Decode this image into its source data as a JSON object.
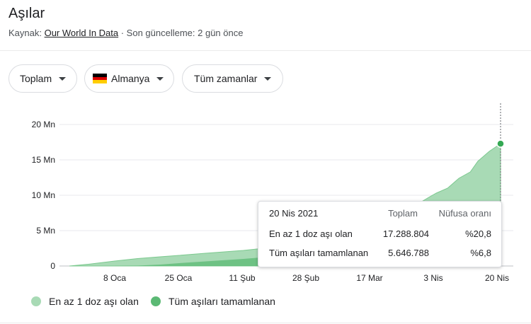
{
  "header": {
    "title": "Aşılar",
    "source_prefix": "Kaynak: ",
    "source_link": "Our World In Data",
    "source_suffix": " · Son güncelleme: 2 gün önce"
  },
  "filters": [
    {
      "label": "Toplam"
    },
    {
      "label": "Almanya",
      "flag": [
        "#000000",
        "#dd0000",
        "#ffce00"
      ]
    },
    {
      "label": "Tüm zamanlar"
    }
  ],
  "tooltip": {
    "date": "20 Nis 2021",
    "col1": "Toplam",
    "col2": "Nüfusa oranı",
    "rows": [
      {
        "label": "En az 1 doz aşı olan",
        "total": "17.288.804",
        "pct": "%20,8"
      },
      {
        "label": "Tüm aşıları tamamlanan",
        "total": "5.646.788",
        "pct": "%6,8"
      }
    ]
  },
  "legend": [
    {
      "label": "En az 1 doz aşı olan",
      "color": "#a8dab5"
    },
    {
      "label": "Tüm aşıları tamamlanan",
      "color": "#5bb974"
    }
  ],
  "chart_data": {
    "type": "area",
    "y_ticks": [
      "0",
      "5 Mn",
      "10 Mn",
      "15 Mn",
      "20 Mn"
    ],
    "x_ticks": [
      "8 Oca",
      "25 Oca",
      "11 Şub",
      "28 Şub",
      "17 Mar",
      "3 Nis",
      "20 Nis"
    ],
    "ylim": [
      0,
      20000000
    ],
    "x": [
      "2020-12-27",
      "2021-01-01",
      "2021-01-08",
      "2021-01-14",
      "2021-01-20",
      "2021-01-25",
      "2021-02-01",
      "2021-02-11",
      "2021-02-20",
      "2021-02-28",
      "2021-03-06",
      "2021-03-12",
      "2021-03-17",
      "2021-03-22",
      "2021-03-28",
      "2021-04-01",
      "2021-04-03",
      "2021-04-06",
      "2021-04-09",
      "2021-04-12",
      "2021-04-14",
      "2021-04-17",
      "2021-04-20"
    ],
    "series": [
      {
        "name": "En az 1 doz aşı olan",
        "values": [
          0,
          250000,
          700000,
          1050000,
          1300000,
          1500000,
          1800000,
          2200000,
          2700000,
          3300000,
          4000000,
          5000000,
          5900000,
          7000000,
          8400000,
          9700000,
          10300000,
          11000000,
          12400000,
          13300000,
          14800000,
          16200000,
          17288804
        ],
        "color": "#a8dab5"
      },
      {
        "name": "Tüm aşıları tamamlanan",
        "values": [
          0,
          0,
          0,
          50000,
          200000,
          400000,
          650000,
          1000000,
          1400000,
          1800000,
          2200000,
          2600000,
          3000000,
          3400000,
          3700000,
          3900000,
          4000000,
          4200000,
          4500000,
          4800000,
          5100000,
          5400000,
          5646788
        ],
        "color": "#5bb974"
      }
    ],
    "grid": true
  }
}
